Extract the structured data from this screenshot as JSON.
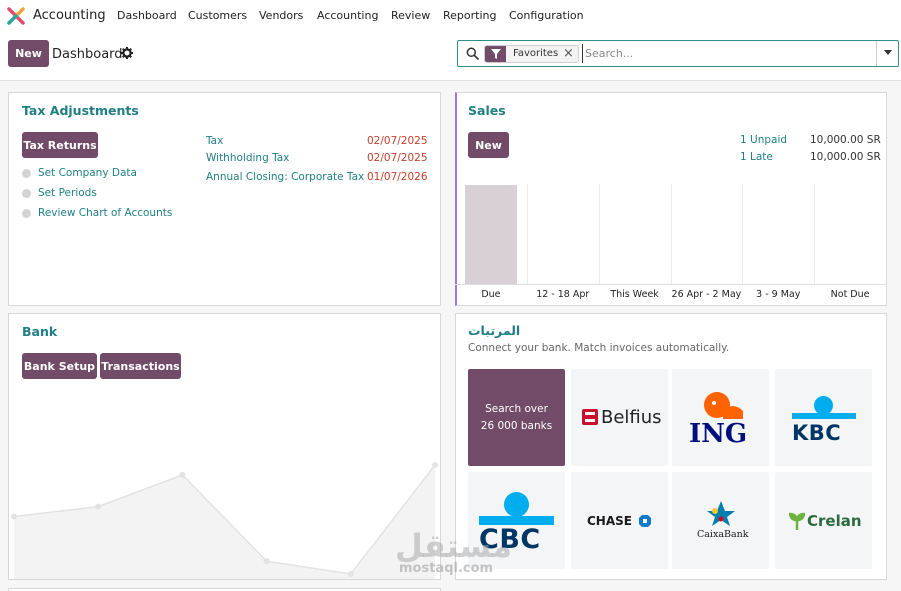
{
  "app": {
    "name": "Accounting",
    "menu": [
      "Dashboard",
      "Customers",
      "Vendors",
      "Accounting",
      "Review",
      "Reporting",
      "Configuration"
    ]
  },
  "control": {
    "new_label": "New",
    "title": "Dashboard",
    "search": {
      "facet": "Favorites",
      "placeholder": "Search..."
    }
  },
  "tax": {
    "title": "Tax Adjustments",
    "button": "Tax Returns",
    "steps": [
      "Set Company Data",
      "Set Periods",
      "Review Chart of Accounts"
    ],
    "deadlines": [
      {
        "label": "Tax",
        "date": "02/07/2025"
      },
      {
        "label": "Withholding Tax",
        "date": "02/07/2025"
      },
      {
        "label": "Annual Closing: Corporate Tax",
        "date": "01/07/2026"
      }
    ]
  },
  "sales": {
    "title": "Sales",
    "button": "New",
    "stats": [
      {
        "label": "1 Unpaid",
        "amount": "10,000.00 SR"
      },
      {
        "label": "1 Late",
        "amount": "10,000.00 SR"
      }
    ],
    "chart_data": {
      "type": "bar",
      "categories": [
        "Due",
        "12 - 18 Apr",
        "This Week",
        "26 Apr - 2 May",
        "3 - 9 May",
        "Not Due"
      ],
      "values": [
        1,
        0,
        0,
        0,
        0,
        0
      ],
      "bar_color": "#d9cfd6"
    }
  },
  "bank": {
    "title": "Bank",
    "buttons": [
      "Bank Setup",
      "Transactions"
    ],
    "chart_data": {
      "type": "area",
      "values": [
        0.58,
        0.68,
        1.0,
        0.13,
        0.0,
        1.1
      ],
      "line_color": "#e3e3e3",
      "fill_color": "#f3f3f3"
    }
  },
  "onboarding": {
    "title": "المرتبات",
    "subtitle": "Connect your bank. Match invoices automatically.",
    "search_tile": {
      "line1": "Search over",
      "line2": "26 000 banks"
    },
    "banks": [
      "Belfius",
      "ING",
      "KBC",
      "CBC",
      "CHASE",
      "CaixaBank",
      "Crelan"
    ]
  },
  "watermark": {
    "main": "مستقل",
    "sub": "mostaql.com"
  },
  "colors": {
    "primary": "#714b67",
    "link": "#1f7f85",
    "overdue": "#c2402e",
    "sales_accent": "#9b7bd1"
  }
}
